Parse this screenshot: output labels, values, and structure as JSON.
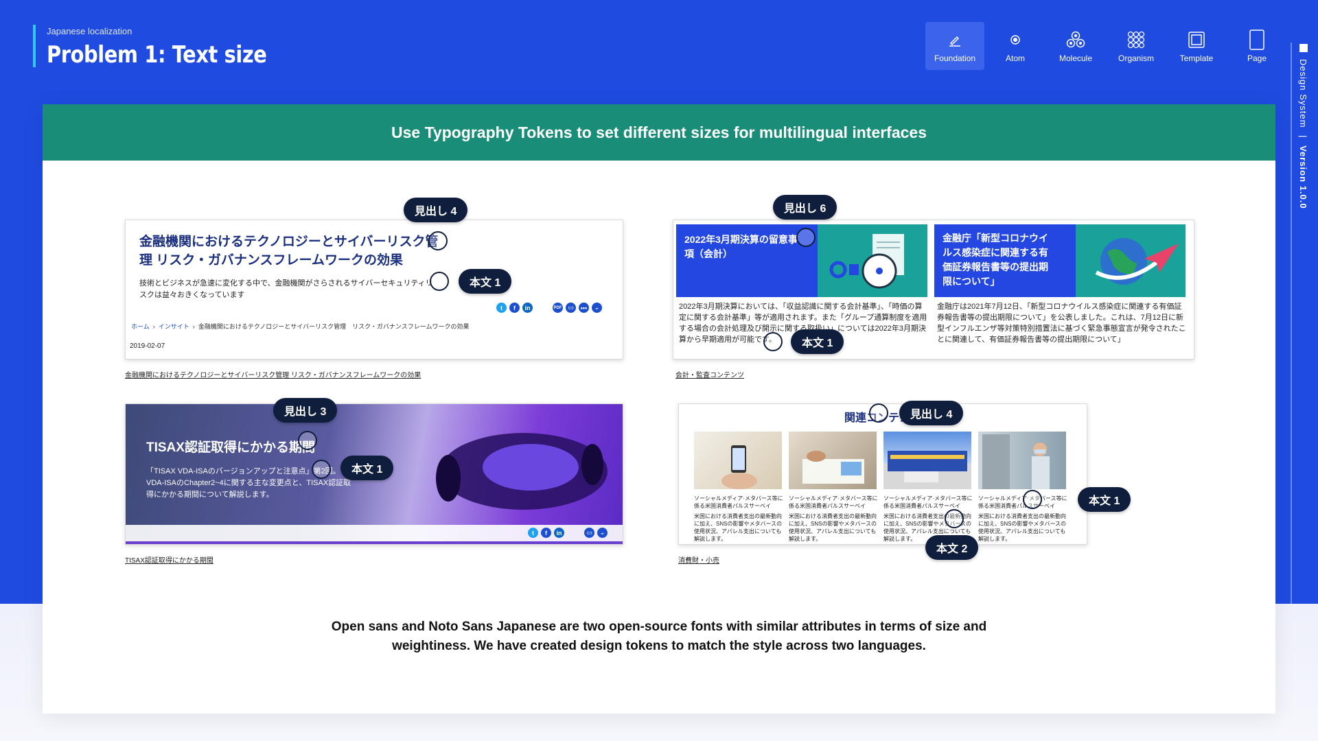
{
  "header": {
    "subtitle": "Japanese localization",
    "title": "Problem 1: Text size"
  },
  "nav": {
    "items": [
      {
        "label": "Foundation",
        "icon": "pen-icon",
        "active": true
      },
      {
        "label": "Atom",
        "icon": "atom-icon",
        "active": false
      },
      {
        "label": "Molecule",
        "icon": "molecule-icon",
        "active": false
      },
      {
        "label": "Organism",
        "icon": "organism-icon",
        "active": false
      },
      {
        "label": "Template",
        "icon": "template-icon",
        "active": false
      },
      {
        "label": "Page",
        "icon": "page-icon",
        "active": false
      }
    ]
  },
  "sidebar": {
    "label": "Design System",
    "separator": "|",
    "version": "Version 1.0.0"
  },
  "banner": {
    "text": "Use Typography Tokens to set different sizes for multilingual interfaces"
  },
  "panel1": {
    "title": "金融機関におけるテクノロジーとサイバーリスク管理 リスク・ガバナンスフレームワークの効果",
    "body": "技術とビジネスが急速に変化する中で、金融機関がさらされるサイバーセキュリティリスクは益々おきくなっています",
    "crumb_home": "ホーム",
    "crumb_sep": "›",
    "crumb_insight": "インサイト",
    "crumb_current": "金融機関におけるテクノロジーとサイバーリスク管理　リスク・ガバナンスフレームワークの効果",
    "date": "2019-02-07",
    "caption": "金融機関におけるテクノロジーとサイバーリスク管理 リスク・ガバナンスフレームワークの効果",
    "tag_heading": "見出し 4",
    "tag_body": "本文 1",
    "pdf_label": "PDF"
  },
  "panel2": {
    "tile1_title": "2022年3月期決算の留意事項（会計）",
    "tile2_title": "金融庁「新型コロナウイルス感染症に関連する有価証券報告書等の提出期限について」",
    "text1": "2022年3月期決算においては、「収益認識に関する会計基準」、「時価の算定に関する会計基準」等が適用されます。また「グループ通算制度を適用する場合の会計処理及び開示に関する取扱い」については2022年3月期決算から早期適用が可能です。",
    "text2": "金融庁は2021年7月12日、「新型コロナウイルス感染症に関連する有価証券報告書等の提出期限について」を公表しました。これは、7月12日に新型インフルエンザ等対策特別措置法に基づく緊急事態宣言が発令されたことに関連して、有価証券報告書等の提出期限について」",
    "caption": "会計・監査コンテンツ",
    "tag_heading": "見出し 6",
    "tag_body": "本文 1"
  },
  "panel3": {
    "title": "TISAX認証取得にかかる期間",
    "body": "「TISAX VDA-ISAのバージョンアップと注意点」第2回。VDA-ISAのChapter2~4に関する主な変更点と、TISAX認証取得にかかる期間について解説します。",
    "caption": "TISAX認証取得にかかる期間",
    "tag_heading": "見出し 3",
    "tag_body": "本文 1"
  },
  "panel4": {
    "heading": "関連コンテンツ",
    "item_title": "ソーシャルメディア·メタバース等に係る米国消費者パルスサーベイ",
    "item_body": "米国における消費者支出の最新動向に加え、SNSの影響やメタバースの使用状況、アパレル支出についても解説します。",
    "caption": "消費財・小売",
    "tag_heading": "見出し 4",
    "tag_body1": "本文 1",
    "tag_body2": "本文 2"
  },
  "footnote": {
    "text": "Open sans and Noto Sans Japanese are two open-source fonts with similar attributes in terms of size and weightiness. We have created design tokens to match the style across two languages."
  },
  "colors": {
    "primary_blue": "#1f4be0",
    "banner_green": "#1a8d78",
    "tag_navy": "#0e1e3c",
    "accent_cyan": "#35c7ea"
  }
}
